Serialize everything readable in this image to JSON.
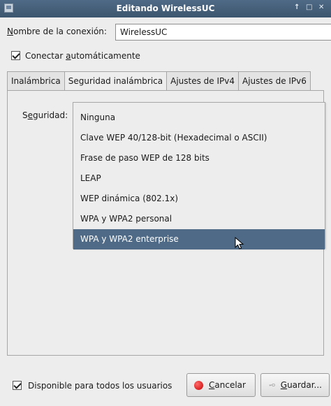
{
  "window": {
    "title": "Editando WirelessUC",
    "controls": [
      "↑",
      "□",
      "✕"
    ]
  },
  "connection": {
    "name_label_mnemonic": "N",
    "name_label_rest": "ombre de la conexión:",
    "name_value": "WirelessUC"
  },
  "auto_connect": {
    "label_pre": "Conectar ",
    "label_mnemonic": "a",
    "label_post": "utomáticamente",
    "checked": true
  },
  "tabs": [
    {
      "label": "Inalámbrica"
    },
    {
      "label": "Seguridad inalámbrica"
    },
    {
      "label": "Ajustes de IPv4"
    },
    {
      "label": "Ajustes de IPv6"
    }
  ],
  "security": {
    "label_pre": "S",
    "label_mnemonic": "e",
    "label_post": "guridad:",
    "options": [
      "Ninguna",
      "Clave WEP 40/128-bit (Hexadecimal o ASCII)",
      "Frase de paso WEP de 128 bits",
      "LEAP",
      "WEP dinámica (802.1x)",
      "WPA y WPA2 personal",
      "WPA y WPA2 enterprise"
    ],
    "selected_index": 6
  },
  "footer": {
    "all_users_label": "Disponible para todos los usuarios",
    "all_users_checked": true,
    "cancel_mnemonic": "C",
    "cancel_rest": "ancelar",
    "save_mnemonic": "G",
    "save_rest": "uardar..."
  },
  "colors": {
    "titlebar": "#4f6a86",
    "selection": "#4f6a86",
    "window_bg": "#ededed"
  }
}
